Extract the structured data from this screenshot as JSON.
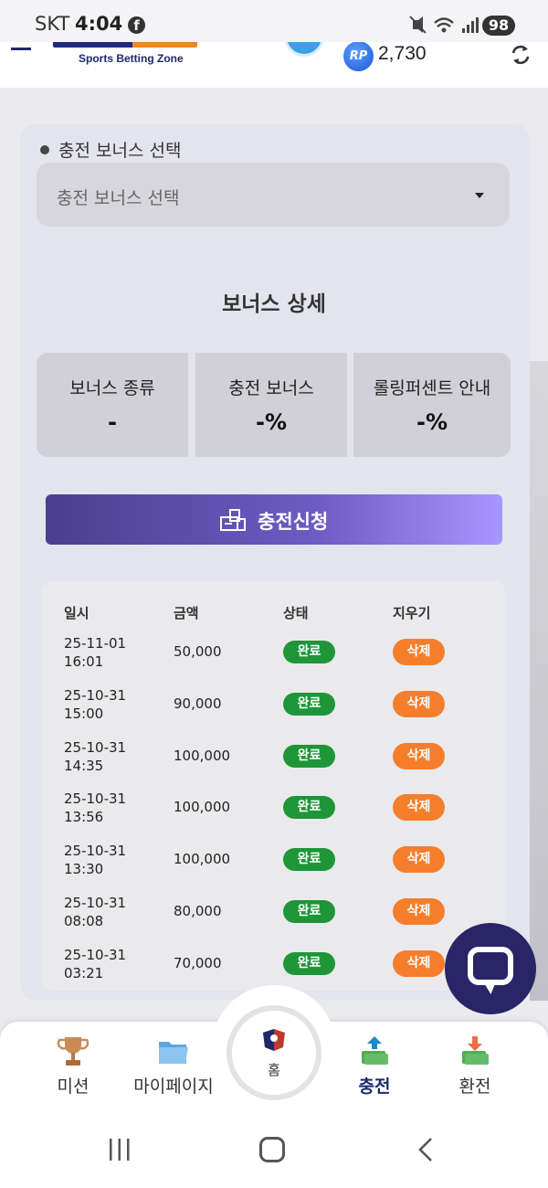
{
  "status_bar": {
    "carrier": "SKT",
    "time": "4:04",
    "facebook_glyph": "f",
    "battery": "98"
  },
  "header": {
    "logo_subtitle": "Sports Betting Zone",
    "rp_badge": "RP",
    "rp_value": "2,730"
  },
  "bonus": {
    "section_label": "충전 보너스 선택",
    "select_placeholder": "충전 보너스 선택",
    "detail_title": "보너스 상세",
    "stats": [
      {
        "label": "보너스 종류",
        "value": "-"
      },
      {
        "label": "충전 보너스",
        "value": "-%"
      },
      {
        "label": "롤링퍼센트 안내",
        "value": "-%"
      }
    ],
    "submit_label": "충전신청"
  },
  "history": {
    "headers": [
      "일시",
      "금액",
      "상태",
      "지우기"
    ],
    "rows": [
      {
        "date": "25-11-01",
        "time": "16:01",
        "amount": "50,000",
        "status": "완료",
        "action": "삭제"
      },
      {
        "date": "25-10-31",
        "time": "15:00",
        "amount": "90,000",
        "status": "완료",
        "action": "삭제"
      },
      {
        "date": "25-10-31",
        "time": "14:35",
        "amount": "100,000",
        "status": "완료",
        "action": "삭제"
      },
      {
        "date": "25-10-31",
        "time": "13:56",
        "amount": "100,000",
        "status": "완료",
        "action": "삭제"
      },
      {
        "date": "25-10-31",
        "time": "13:30",
        "amount": "100,000",
        "status": "완료",
        "action": "삭제"
      },
      {
        "date": "25-10-31",
        "time": "08:08",
        "amount": "80,000",
        "status": "완료",
        "action": "삭제"
      },
      {
        "date": "25-10-31",
        "time": "03:21",
        "amount": "70,000",
        "status": "완료",
        "action": "삭제"
      }
    ]
  },
  "bottom_nav": {
    "mission": "미션",
    "mypage": "마이페이지",
    "home": "홈",
    "charge": "충전",
    "exchange": "환전"
  },
  "colors": {
    "accent_purple": "#6e5cc4",
    "status_done_green": "#1e9638",
    "delete_orange": "#f57e2c",
    "chat_navy": "#2a2566"
  },
  "icons": {
    "chat": "chat-bubble-icon",
    "refresh": "refresh-icon",
    "trophy": "trophy-icon",
    "folder": "folder-icon",
    "charge": "money-up-icon",
    "exchange": "money-down-icon"
  }
}
